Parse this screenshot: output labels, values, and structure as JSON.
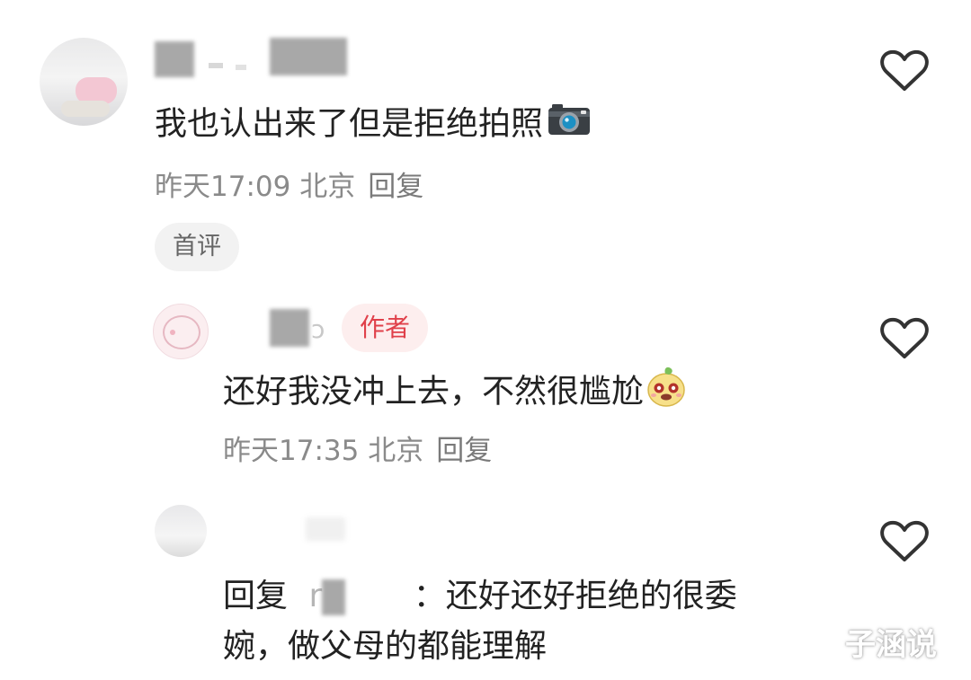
{
  "comments": [
    {
      "text": "我也认出来了但是拒绝拍照",
      "emoji_icon": "camera-icon",
      "time": "昨天17:09 北京",
      "reply_label": "回复",
      "badge": "首评"
    },
    {
      "author_partial": "ɔ",
      "author_badge": "作者",
      "text": "还好我没冲上去，不然很尴尬",
      "emoji_icon": "face-emoji-icon",
      "time": "昨天17:35 北京",
      "reply_label": "回复"
    },
    {
      "reply_prefix": "回复",
      "reply_target_partial": "r",
      "reply_colon": "：",
      "line1_rest": "还好还好拒绝的很委",
      "line2": "婉，做父母的都能理解"
    }
  ],
  "watermark": "子涵说",
  "colors": {
    "author_badge_text": "#e0404a",
    "author_badge_bg": "#fdeeee",
    "meta_text": "#8a8a8a"
  },
  "icons": [
    "heart-outline-icon"
  ]
}
